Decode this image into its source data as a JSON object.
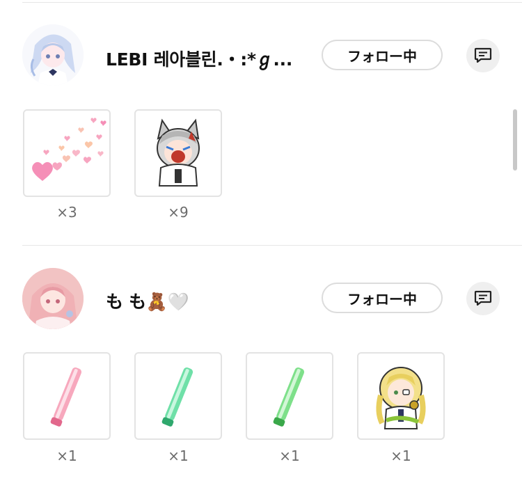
{
  "users": [
    {
      "name": "LEBI 레아블린.・:*ℊ...",
      "follow_label": "フォロー中",
      "gifts": [
        {
          "icon": "hearts-sticker",
          "count": "×3"
        },
        {
          "icon": "wolf-character-sticker",
          "count": "×9"
        }
      ]
    },
    {
      "name": "も も🧸🤍",
      "follow_label": "フォロー中",
      "gifts": [
        {
          "icon": "pink-glowstick",
          "count": "×1"
        },
        {
          "icon": "green-glowstick",
          "count": "×1"
        },
        {
          "icon": "green-glowstick",
          "count": "×1"
        },
        {
          "icon": "blonde-character-sticker",
          "count": "×1"
        }
      ]
    }
  ],
  "colors": {
    "card_border": "#e3e3e3",
    "button_border": "#dcdcdc",
    "message_button_bg": "#efefef",
    "count_text": "#6b6b6b"
  },
  "icons": {
    "message": "chat-bubble-icon"
  }
}
